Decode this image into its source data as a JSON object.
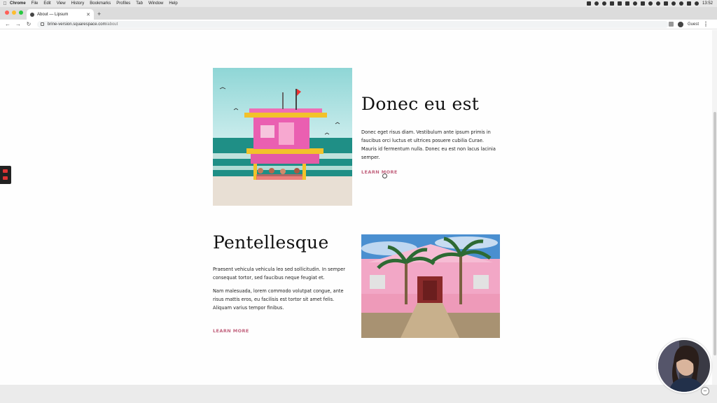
{
  "menubar": {
    "app": "Chrome",
    "items": [
      "File",
      "Edit",
      "View",
      "History",
      "Bookmarks",
      "Profiles",
      "Tab",
      "Window",
      "Help"
    ],
    "time": "13:52"
  },
  "browser": {
    "tab_title": "About — Lipsum",
    "url_host": "brine-version.squarespace.com",
    "url_path": "/about",
    "profile": "Guest"
  },
  "sections": [
    {
      "heading": "Donec eu est",
      "paragraphs": [
        "Donec eget risus diam. Vestibulum ante ipsum primis in faucibus orci luctus et ultrices posuere cubilia Curae. Mauris id fermentum nulla. Donec eu est non lacus lacinia semper."
      ],
      "link": "LEARN MORE"
    },
    {
      "heading": "Pentellesque",
      "paragraphs": [
        "Praesent vehicula vehicula leo sed sollicitudin. In semper consequat tortor, sed faucibus neque feugiat et.",
        "Nam malesuada, lorem commodo volutpat congue, ante risus mattis eros, eu facilisis est tortor sit amet felis. Aliquam varius tempor finibus."
      ],
      "link": "LEARN MORE"
    }
  ],
  "colors": {
    "link": "#c2637e",
    "heading": "#111111",
    "footer": "#ebebeb"
  }
}
